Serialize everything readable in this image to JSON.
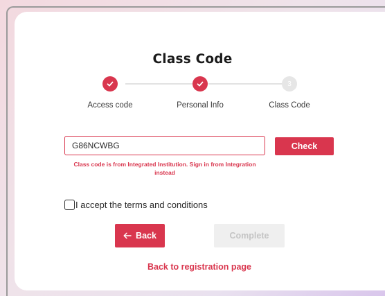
{
  "page": {
    "title": "Class Code"
  },
  "stepper": {
    "steps": [
      {
        "label": "Access code",
        "status": "done"
      },
      {
        "label": "Personal Info",
        "status": "done"
      },
      {
        "label": "Class Code",
        "status": "pending",
        "number": "3"
      }
    ]
  },
  "form": {
    "class_code_value": "G86NCWBG",
    "check_label": "Check",
    "error_message": "Class code is from Integrated Institution. Sign in from Integration instead",
    "terms_label": "I accept the terms and conditions",
    "terms_checked": false
  },
  "actions": {
    "back_label": "Back",
    "back_icon": "arrow-left-icon",
    "complete_label": "Complete",
    "registration_link": "Back to registration page"
  },
  "colors": {
    "accent": "#d9364e",
    "disabled_bg": "#efefef",
    "disabled_text": "#c4c4c4"
  }
}
